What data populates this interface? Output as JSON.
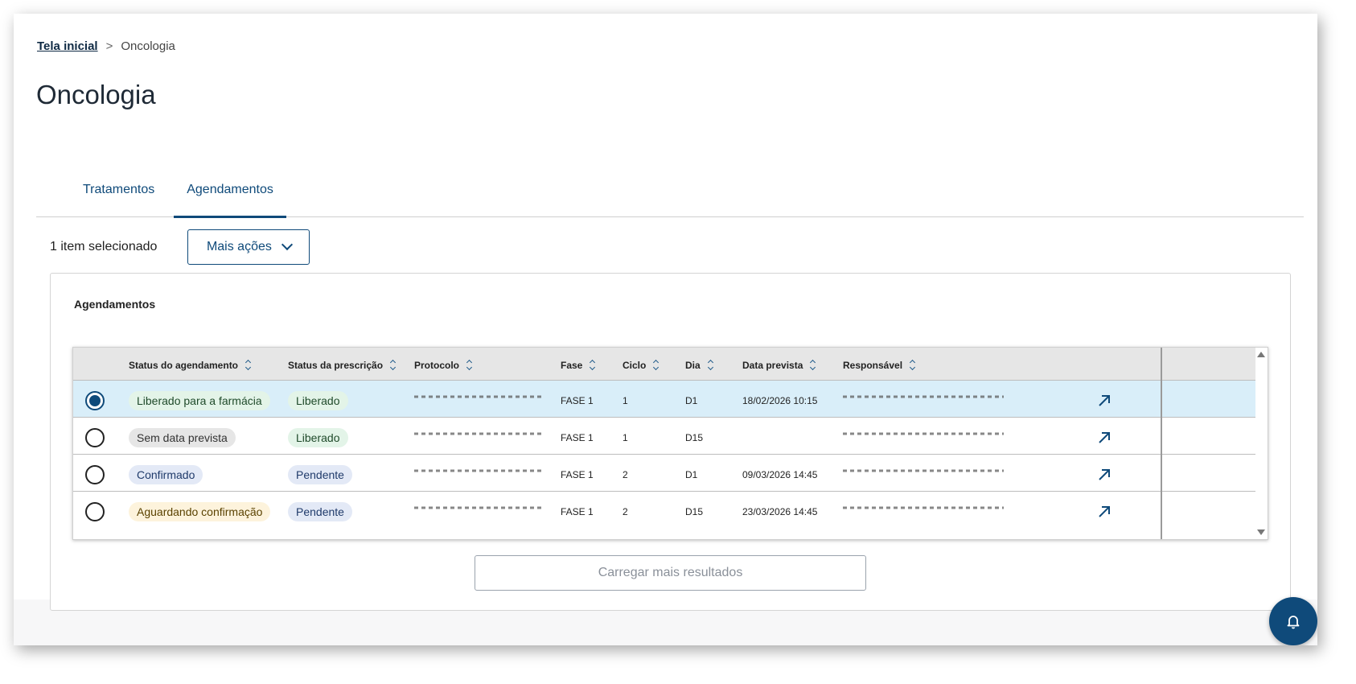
{
  "breadcrumb": {
    "home": "Tela inicial",
    "separator": ">",
    "current": "Oncologia"
  },
  "page": {
    "title": "Oncologia"
  },
  "tabs": [
    {
      "label": "Tratamentos",
      "active": false
    },
    {
      "label": "Agendamentos",
      "active": true
    }
  ],
  "selection": {
    "count_label": "1 item selecionado",
    "actions_label": "Mais ações"
  },
  "card": {
    "title": "Agendamentos"
  },
  "table": {
    "headers": {
      "status_agendamento": "Status do agendamento",
      "status_prescricao": "Status da prescrição",
      "protocolo": "Protocolo",
      "fase": "Fase",
      "ciclo": "Ciclo",
      "dia": "Dia",
      "data_prevista": "Data prevista",
      "responsavel": "Responsável"
    },
    "rows": [
      {
        "selected": true,
        "status_agendamento": "Liberado para a farmácia",
        "status_prescricao": "Liberado",
        "fase": "FASE 1",
        "ciclo": "1",
        "dia": "D1",
        "data_prevista": "18/02/2026 10:15"
      },
      {
        "selected": false,
        "status_agendamento": "Sem data prevista",
        "status_prescricao": "Liberado",
        "fase": "FASE 1",
        "ciclo": "1",
        "dia": "D15",
        "data_prevista": ""
      },
      {
        "selected": false,
        "status_agendamento": "Confirmado",
        "status_prescricao": "Pendente",
        "fase": "FASE 1",
        "ciclo": "2",
        "dia": "D1",
        "data_prevista": "09/03/2026 14:45"
      },
      {
        "selected": false,
        "status_agendamento": "Aguardando confirmação",
        "status_prescricao": "Pendente",
        "fase": "FASE 1",
        "ciclo": "2",
        "dia": "D15",
        "data_prevista": "23/03/2026 14:45"
      }
    ]
  },
  "load_more": {
    "label": "Carregar mais resultados"
  },
  "colors": {
    "primary": "#0f4a7a",
    "selected_row": "#d9eef9",
    "badge_green_bg": "#e3f4e8",
    "badge_gray_bg": "#e6e6e6",
    "badge_blue_bg": "#e3e9f6",
    "badge_yellow_bg": "#fdf3dc"
  },
  "icons": {
    "open": "arrow-up-right-icon",
    "notifications": "bell-icon",
    "sort": "sort-icon"
  }
}
